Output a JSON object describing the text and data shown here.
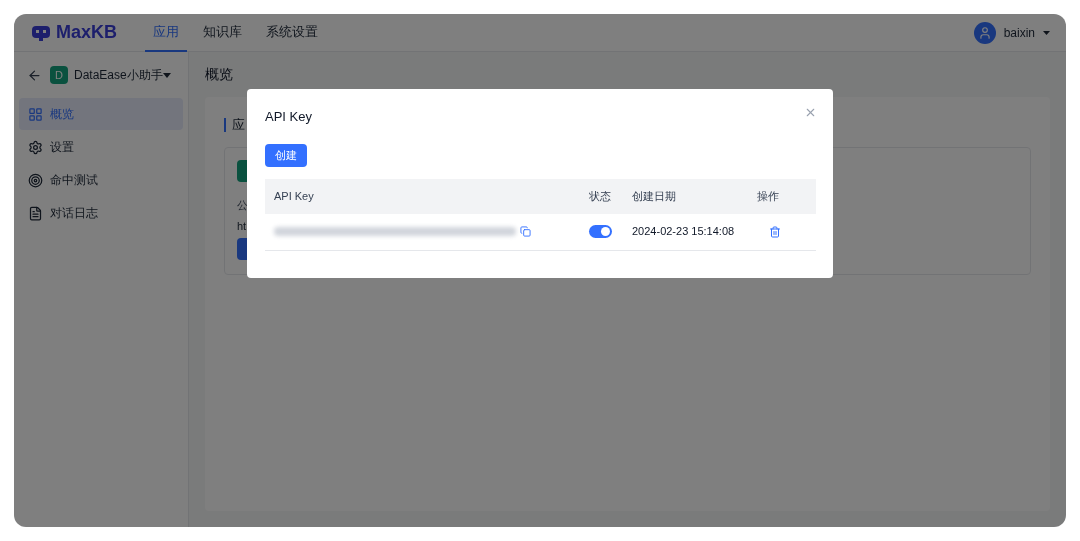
{
  "header": {
    "logo": "MaxKB",
    "nav": [
      {
        "label": "应用",
        "selected": true
      },
      {
        "label": "知识库",
        "selected": false
      },
      {
        "label": "系统设置",
        "selected": false
      }
    ],
    "user": "baixin"
  },
  "sidebar": {
    "app_avatar": "D",
    "app_name": "DataEase小助手",
    "items": [
      {
        "label": "概览",
        "selected": true
      },
      {
        "label": "设置",
        "selected": false
      },
      {
        "label": "命中测试",
        "selected": false
      },
      {
        "label": "对话日志",
        "selected": false
      }
    ]
  },
  "main": {
    "title": "概览",
    "section_heading": "应",
    "card_lines": [
      "公",
      "ht"
    ]
  },
  "dialog": {
    "title": "API Key",
    "create_button": "创建",
    "columns": [
      "API Key",
      "状态",
      "创建日期",
      "操作"
    ],
    "rows": [
      {
        "on": true,
        "created": "2024-02-23 15:14:08"
      }
    ]
  }
}
